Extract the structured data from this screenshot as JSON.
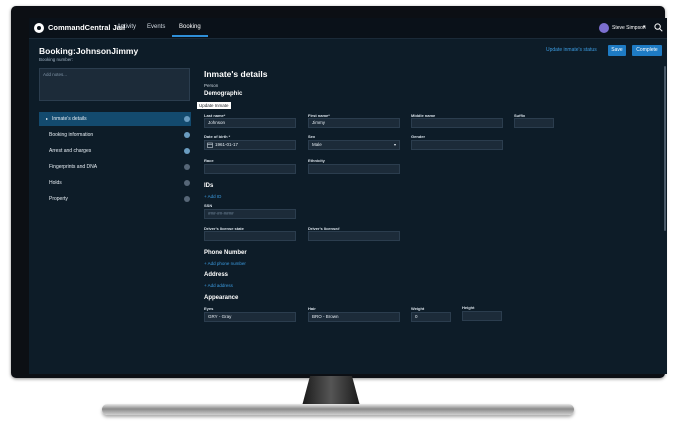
{
  "topbar": {
    "app_name": "CommandCentral Jail",
    "tabs": [
      {
        "label": "Activity"
      },
      {
        "label": "Events"
      },
      {
        "label": "Booking",
        "active": true
      }
    ],
    "user_name": "Steve Simpson",
    "chevron": "▾"
  },
  "header": {
    "title": "Booking:JohnsonJimmy",
    "subtitle": "Booking number:",
    "update_status_label": "Update inmate's status",
    "save_label": "Save",
    "complete_label": "Complete"
  },
  "notes": {
    "placeholder": "Add notes..."
  },
  "sidebar": {
    "items": [
      {
        "label": "Inmate's details",
        "active": true,
        "caret": "▸",
        "status": "complete"
      },
      {
        "label": "Booking information",
        "status": "complete"
      },
      {
        "label": "Arrest and charges",
        "status": "complete"
      },
      {
        "label": "Fingerprints and DNA",
        "status": "pending"
      },
      {
        "label": "Holds",
        "status": "pending"
      },
      {
        "label": "Property",
        "status": "pending"
      }
    ]
  },
  "main": {
    "title": "Inmate's details",
    "person_label": "Person",
    "demographic_heading": "Demographic",
    "update_inmate_tag": "Update Inmate",
    "fields": {
      "last_name": {
        "label": "Last name*",
        "value": "Johnson"
      },
      "first_name": {
        "label": "First name*",
        "value": "Jimmy"
      },
      "middle_name": {
        "label": "Middle name",
        "value": ""
      },
      "suffix": {
        "label": "Suffix",
        "value": ""
      },
      "dob": {
        "label": "Date of birth *",
        "value": "1961-01-17"
      },
      "sex": {
        "label": "Sex",
        "value": "Male"
      },
      "gender": {
        "label": "Gender",
        "value": ""
      },
      "race": {
        "label": "Race",
        "value": ""
      },
      "ethnicity": {
        "label": "Ethnicity",
        "value": ""
      }
    },
    "ids": {
      "heading": "IDs",
      "add_label": "+ Add ID",
      "ssn_label": "SSN",
      "ssn_placeholder": "###-##-####",
      "license_state_label": "Driver's license state",
      "license_label": "Driver's license#"
    },
    "phone": {
      "heading": "Phone Number",
      "add_label": "+ Add phone number"
    },
    "address": {
      "heading": "Address",
      "add_label": "+ Add address"
    },
    "appearance": {
      "heading": "Appearance",
      "eyes": {
        "label": "Eyes",
        "value": "GRY - Gray"
      },
      "hair": {
        "label": "Hair",
        "value": "BRO - Brown"
      },
      "weight": {
        "label": "Weight",
        "value": "0"
      },
      "height": {
        "label": "Height",
        "value": ""
      }
    }
  },
  "colors": {
    "background": "#0d1c28",
    "accent": "#1e7bc4",
    "link": "#3b9be0",
    "active_sidebar": "#134a6e"
  },
  "icons": [
    "logo-icon",
    "search-icon",
    "calendar-icon",
    "dropdown-chevron-icon",
    "status-dot-icon"
  ]
}
